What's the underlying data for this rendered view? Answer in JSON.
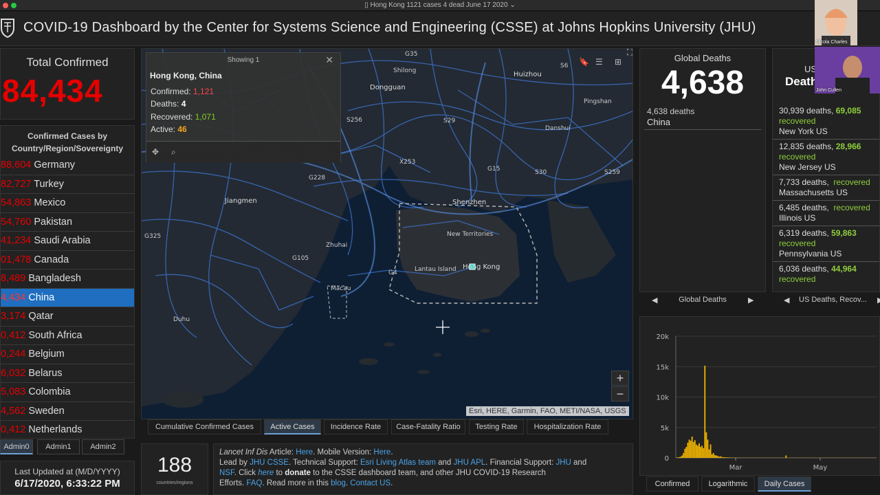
{
  "window": {
    "title": "Hong Kong 1121 cases 4 dead June 17 2020 ⌄"
  },
  "header": {
    "title": "COVID-19 Dashboard by the Center for Systems Science and Engineering (CSSE) at Johns Hopkins University (JHU)"
  },
  "total_confirmed": {
    "label": "Total Confirmed",
    "value": "84,434"
  },
  "confirmed_by_country": {
    "title_line1": "Confirmed Cases by",
    "title_line2": "Country/Region/Sovereignty",
    "rows": [
      {
        "num": "88,604",
        "name": "Germany"
      },
      {
        "num": "82,727",
        "name": "Turkey"
      },
      {
        "num": "54,863",
        "name": "Mexico"
      },
      {
        "num": "54,760",
        "name": "Pakistan"
      },
      {
        "num": "41,234",
        "name": "Saudi Arabia"
      },
      {
        "num": "01,478",
        "name": "Canada"
      },
      {
        "num": "8,489",
        "name": "Bangladesh"
      },
      {
        "num": "4,434",
        "name": "China"
      },
      {
        "num": "3,174",
        "name": "Qatar"
      },
      {
        "num": "0,412",
        "name": "South Africa"
      },
      {
        "num": "0,244",
        "name": "Belgium"
      },
      {
        "num": "6,032",
        "name": "Belarus"
      },
      {
        "num": "5,083",
        "name": "Colombia"
      },
      {
        "num": "4,562",
        "name": "Sweden"
      },
      {
        "num": "0,412",
        "name": "Netherlands"
      }
    ]
  },
  "admin_tabs": [
    "Admin0",
    "Admin1",
    "Admin2"
  ],
  "last_updated": {
    "label": "Last Updated at (M/D/YYYY)",
    "value": "6/17/2020, 6:33:22 PM"
  },
  "popup": {
    "header": "Showing 1",
    "location": "Hong Kong, China",
    "confirmed_label": "Confirmed:",
    "confirmed": "1,121",
    "deaths_label": "Deaths:",
    "deaths": "4",
    "recovered_label": "Recovered:",
    "recovered": "1,071",
    "active_label": "Active:",
    "active": "46"
  },
  "map": {
    "attribution": "Esri, HERE, Garmin, FAO, METI/NASA, USGS",
    "labels": {
      "g35": "G35",
      "shilong": "Shilong",
      "huizhou": "Huizhou",
      "dongguan": "Dongguan",
      "s256": "S256",
      "s29": "S29",
      "x253": "X253",
      "g15": "G15",
      "s30": "S30",
      "s259": "S259",
      "g228": "G228",
      "jiangmen": "Jiangmen",
      "shenzhen": "Shenzhen",
      "new_territories": "New Territories",
      "g325": "G325",
      "zhuhai": "Zhuhai",
      "g105": "G105",
      "lantau": "Lantau Island",
      "hongkong": "Hong Kong",
      "g4": "G4",
      "macau": "Macau",
      "duhu": "Duhu",
      "danshui": "Danshui",
      "pingshan": "Pingshan",
      "s6": "S6"
    }
  },
  "map_tabs": [
    "Cumulative Confirmed Cases",
    "Active Cases",
    "Incidence Rate",
    "Case-Fatality Ratio",
    "Testing Rate",
    "Hospitalization Rate"
  ],
  "countries": {
    "count": "188",
    "label": "countries/regions"
  },
  "info": {
    "p1": "Lancet Inf Dis",
    "p2": " Article: ",
    "p3": "Here",
    "p4": ". Mobile Version: ",
    "p5": "Here",
    "p6": ".",
    "p7": "Lead by ",
    "p8": "JHU CSSE",
    "p9": ". Technical Support: ",
    "p10": "Esri Living Atlas team",
    "p11": " and ",
    "p12": "JHU APL",
    "p13": ". Financial Support: ",
    "p14": "JHU",
    "p15": " and",
    "p16": "NSF",
    "p17": ". Click ",
    "p18": "here",
    "p19": " to ",
    "p20": "donate",
    "p21": " to the CSSE dashboard team, and other JHU COVID-19 Research",
    "p22": "Efforts. ",
    "p23": "FAQ",
    "p24": ". Read more in this ",
    "p25": "blog",
    "p26": ". ",
    "p27": "Contact US",
    "p28": "."
  },
  "global_deaths": {
    "label": "Global Deaths",
    "value": "4,638",
    "detail_line1": "4,638 deaths",
    "detail_line2": "China",
    "nav_label": "Global Deaths"
  },
  "us_deaths": {
    "label1": "US",
    "label2": "Death",
    "rows": [
      {
        "deaths": "30,939 deaths,",
        "rec": "69,085",
        "rec_label": "recovered",
        "place": "New York US"
      },
      {
        "deaths": "12,835 deaths,",
        "rec": "28,966",
        "rec_label": "recovered",
        "place": "New Jersey US"
      },
      {
        "deaths": "7,733 deaths,",
        "rec": "",
        "rec_label": "recovered",
        "place": "Massachusetts US"
      },
      {
        "deaths": "6,485 deaths,",
        "rec": "",
        "rec_label": "recovered",
        "place": "Illinois US"
      },
      {
        "deaths": "6,319 deaths,",
        "rec": "59,863",
        "rec_label": "recovered",
        "place": "Pennsylvania US"
      },
      {
        "deaths": "6,036 deaths,",
        "rec": "44,964",
        "rec_label": "recovered",
        "place": ""
      }
    ],
    "nav_label": "US Deaths, Recov..."
  },
  "chart_tabs": [
    "Confirmed",
    "Logarithmic",
    "Daily Cases"
  ],
  "chart_data": {
    "type": "bar",
    "ylim": [
      0,
      20000
    ],
    "yticks": [
      "0",
      "5k",
      "10k",
      "15k",
      "20k"
    ],
    "xticks": [
      "Mar",
      "May"
    ],
    "bar_color": "#f5b800",
    "values": [
      50,
      80,
      120,
      200,
      400,
      800,
      1500,
      1800,
      2500,
      3000,
      2800,
      3500,
      2600,
      2900,
      2200,
      2000,
      2400,
      1800,
      2000,
      1600,
      15150,
      4200,
      3000,
      1400,
      2200,
      600,
      800,
      450,
      400,
      300,
      200,
      250,
      150,
      120,
      100,
      90,
      80,
      70,
      60,
      50,
      45,
      40,
      40,
      35,
      30,
      30,
      30,
      25,
      25,
      20,
      20,
      20,
      20,
      20,
      25,
      20,
      20,
      20,
      20,
      20,
      20,
      20,
      20,
      20,
      20,
      20,
      20,
      20,
      20,
      20,
      20,
      20,
      20,
      20,
      20,
      20,
      20,
      400,
      20,
      20,
      20,
      20,
      20,
      20,
      20,
      20,
      20,
      20,
      20,
      20,
      20,
      20,
      20,
      20,
      20,
      20,
      20,
      20,
      20,
      20,
      20,
      20,
      20,
      20,
      20,
      20,
      20,
      20,
      20,
      20,
      20,
      20,
      20,
      20,
      20,
      20,
      20,
      20,
      20,
      20,
      20,
      20,
      20,
      20,
      20,
      20,
      20,
      20,
      20,
      20,
      20,
      20,
      20,
      20,
      20,
      20,
      20,
      20,
      20,
      20,
      20
    ]
  },
  "webcams": {
    "cam1_name": "Nicola Charles",
    "cam2_name": "John Cullen"
  }
}
